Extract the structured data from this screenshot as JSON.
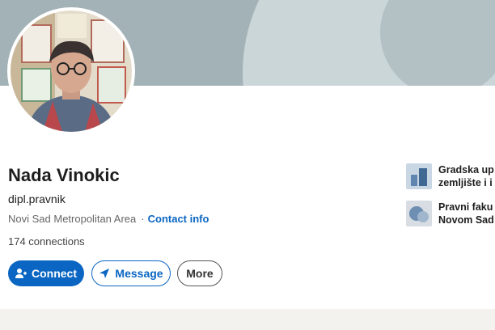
{
  "profile": {
    "name": "Nada Vinokic",
    "headline": "dipl.pravnik",
    "location": "Novi Sad Metropolitan Area",
    "separator": "·",
    "contact_info": "Contact info",
    "connections": "174 connections"
  },
  "actions": {
    "connect": "Connect",
    "message": "Message",
    "more": "More"
  },
  "experience": [
    {
      "line1": "Gradska up",
      "line2": "zemljište i i"
    },
    {
      "line1": "Pravni faku",
      "line2": "Novom Sad"
    }
  ],
  "colors": {
    "accent": "#0a66c2",
    "banner": "#a3b2b6"
  }
}
